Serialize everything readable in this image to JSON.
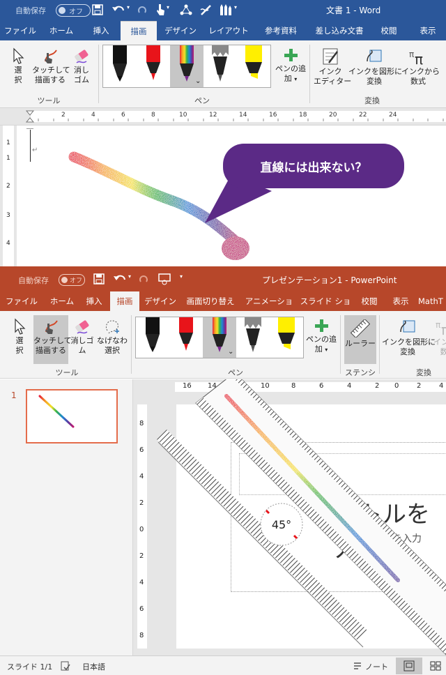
{
  "word": {
    "autosave_label": "自動保存",
    "autosave_state": "オフ",
    "title": "文書 1 - Word",
    "tabs": [
      "ファイル",
      "ホーム",
      "挿入",
      "描画",
      "デザイン",
      "レイアウト",
      "参考資料",
      "差し込み文書",
      "校閲",
      "表示"
    ],
    "active_tab": "描画",
    "tools": {
      "select_label": "選\n択",
      "touch_draw_label": "タッチして\n描画する",
      "eraser_label": "消し\nゴム",
      "group_label": "ツール"
    },
    "pens": {
      "add_pen_label": "ペンの追\n加",
      "group_label": "ペン"
    },
    "convert": {
      "ink_editor_label": "インク\nエディター",
      "ink_to_shape_label": "インクを図形に\n変換",
      "ink_to_math_label": "インクから\n数式",
      "group_label": "変換"
    },
    "ruler_numbers": [
      "2",
      "4",
      "6",
      "8",
      "10",
      "12",
      "14",
      "16",
      "18",
      "20",
      "22",
      "24"
    ],
    "vruler_numbers": [
      "1",
      "1",
      "2",
      "3",
      "4"
    ],
    "callout_text": "直線には出来ない？",
    "paragraph_mark": "↵"
  },
  "ppt": {
    "autosave_label": "自動保存",
    "autosave_state": "オフ",
    "title": "プレゼンテーション1 - PowerPoint",
    "tabs": [
      "ファイル",
      "ホーム",
      "挿入",
      "描画",
      "デザイン",
      "画面切り替え",
      "アニメーション",
      "スライド ショー",
      "校閲",
      "表示",
      "MathT"
    ],
    "active_tab": "描画",
    "tools": {
      "select_label": "選\n択",
      "touch_draw_label": "タッチして\n描画する",
      "eraser_label": "消しゴ\nム",
      "lasso_label": "なげなわ\n選択",
      "group_label": "ツール"
    },
    "pens": {
      "add_pen_label": "ペンの追\n加",
      "group_label": "ペン"
    },
    "stencil": {
      "ruler_label": "ルーラー",
      "group_label": "ステンシル"
    },
    "convert": {
      "ink_to_shape_label": "インクを図形に\n変換",
      "ink_to_math_label": "インク\n数",
      "group_label": "変換"
    },
    "slide_number": "1",
    "ruler_h_numbers": [
      "16",
      "14",
      "12",
      "10",
      "8",
      "6",
      "4",
      "2",
      "0",
      "2",
      "4"
    ],
    "ruler_v_numbers": [
      "8",
      "6",
      "4",
      "2",
      "0",
      "2",
      "4",
      "6",
      "8"
    ],
    "ruler_angle": "45°",
    "slide_title_placeholder": "イトルを入",
    "slide_subtitle_placeholder": "ブタイトルを入力",
    "status": {
      "slide_count": "スライド 1/1",
      "language": "日本語",
      "notes_label": "ノート"
    }
  },
  "colors": {
    "word_blue": "#2b579a",
    "ppt_orange": "#b7472a",
    "callout_purple": "#5b2a86",
    "pen_red": "#e8141a",
    "pen_yellow": "#ffef00"
  }
}
